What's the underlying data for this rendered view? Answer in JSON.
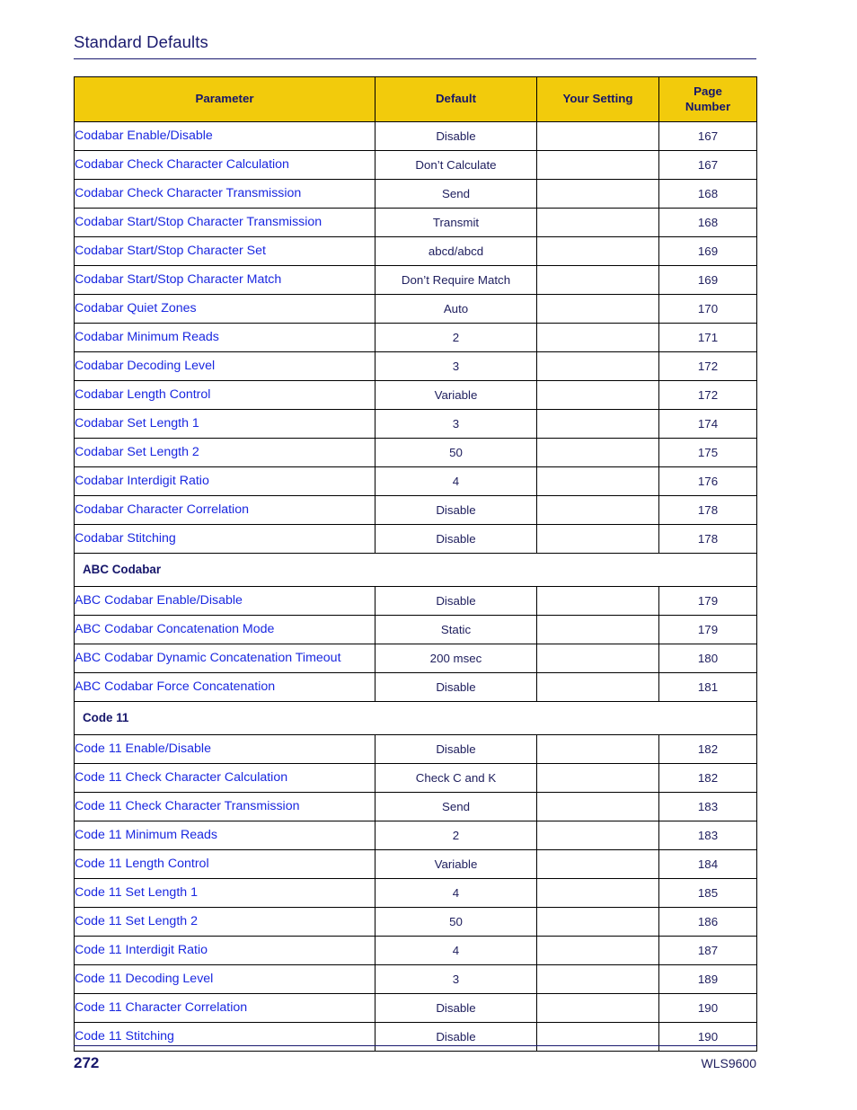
{
  "document": {
    "section_title": "Standard Defaults",
    "footer_page_number": "272",
    "footer_document_name": "WLS9600"
  },
  "colors": {
    "header_background": "#F2CB0C",
    "header_text": "#16166B",
    "link_text": "#1A28E0",
    "body_text": "#20205F",
    "rule": "#1A1A6E"
  },
  "table": {
    "columns": [
      {
        "key": "parameter",
        "label": "Parameter"
      },
      {
        "key": "default",
        "label": "Default"
      },
      {
        "key": "your_setting",
        "label": "Your Setting"
      },
      {
        "key": "page_number",
        "label": "Page\nNumber"
      }
    ],
    "column_labels": {
      "parameter": "Parameter",
      "default": "Default",
      "your_setting": "Your Setting",
      "page_number_line1": "Page",
      "page_number_line2": "Number"
    },
    "rows": [
      {
        "type": "data",
        "parameter": "Codabar Enable/Disable",
        "default": "Disable",
        "your_setting": "",
        "page": "167"
      },
      {
        "type": "data",
        "parameter": "Codabar Check Character Calculation",
        "default": "Don’t Calculate",
        "your_setting": "",
        "page": "167"
      },
      {
        "type": "data",
        "parameter": "Codabar Check Character Transmission",
        "default": "Send",
        "your_setting": "",
        "page": "168"
      },
      {
        "type": "data",
        "parameter": "Codabar Start/Stop Character Transmission",
        "default": "Transmit",
        "your_setting": "",
        "page": "168"
      },
      {
        "type": "data",
        "parameter": "Codabar Start/Stop Character Set",
        "default": "abcd/abcd",
        "your_setting": "",
        "page": "169"
      },
      {
        "type": "data",
        "parameter": "Codabar Start/Stop Character Match",
        "default": "Don’t Require Match",
        "your_setting": "",
        "page": "169"
      },
      {
        "type": "data",
        "parameter": "Codabar Quiet Zones",
        "default": "Auto",
        "your_setting": "",
        "page": "170"
      },
      {
        "type": "data",
        "parameter": "Codabar Minimum Reads",
        "default": "2",
        "your_setting": "",
        "page": "171"
      },
      {
        "type": "data",
        "parameter": "Codabar Decoding Level",
        "default": "3",
        "your_setting": "",
        "page": "172"
      },
      {
        "type": "data",
        "parameter": "Codabar Length Control",
        "default": "Variable",
        "your_setting": "",
        "page": "172"
      },
      {
        "type": "data",
        "parameter": "Codabar Set Length 1",
        "default": "3",
        "your_setting": "",
        "page": "174"
      },
      {
        "type": "data",
        "parameter": "Codabar Set Length 2",
        "default": "50",
        "your_setting": "",
        "page": "175"
      },
      {
        "type": "data",
        "parameter": "Codabar Interdigit Ratio",
        "default": "4",
        "your_setting": "",
        "page": "176"
      },
      {
        "type": "data",
        "parameter": "Codabar Character Correlation",
        "default": "Disable",
        "your_setting": "",
        "page": "178"
      },
      {
        "type": "data",
        "parameter": "Codabar Stitching",
        "default": "Disable",
        "your_setting": "",
        "page": "178"
      },
      {
        "type": "section",
        "parameter": "ABC Codabar"
      },
      {
        "type": "data",
        "parameter": "ABC Codabar Enable/Disable",
        "default": "Disable",
        "your_setting": "",
        "page": "179"
      },
      {
        "type": "data",
        "parameter": "ABC Codabar Concatenation Mode",
        "default": "Static",
        "your_setting": "",
        "page": "179"
      },
      {
        "type": "data",
        "parameter": "ABC Codabar Dynamic Concatenation Timeout",
        "default": "200 msec",
        "your_setting": "",
        "page": "180"
      },
      {
        "type": "data",
        "parameter": "ABC Codabar Force Concatenation",
        "default": "Disable",
        "your_setting": "",
        "page": "181"
      },
      {
        "type": "section",
        "parameter": "Code 11"
      },
      {
        "type": "data",
        "parameter": "Code 11 Enable/Disable",
        "default": "Disable",
        "your_setting": "",
        "page": "182"
      },
      {
        "type": "data",
        "parameter": "Code 11 Check Character Calculation",
        "default": "Check C and K",
        "your_setting": "",
        "page": "182"
      },
      {
        "type": "data",
        "parameter": "Code 11 Check Character Transmission",
        "default": "Send",
        "your_setting": "",
        "page": "183"
      },
      {
        "type": "data",
        "parameter": "Code 11 Minimum Reads",
        "default": "2",
        "your_setting": "",
        "page": "183"
      },
      {
        "type": "data",
        "parameter": "Code 11 Length Control",
        "default": "Variable",
        "your_setting": "",
        "page": "184"
      },
      {
        "type": "data",
        "parameter": "Code 11 Set Length 1",
        "default": "4",
        "your_setting": "",
        "page": "185"
      },
      {
        "type": "data",
        "parameter": "Code 11 Set Length 2",
        "default": "50",
        "your_setting": "",
        "page": "186"
      },
      {
        "type": "data",
        "parameter": "Code 11 Interdigit Ratio",
        "default": "4",
        "your_setting": "",
        "page": "187"
      },
      {
        "type": "data",
        "parameter": "Code 11 Decoding Level",
        "default": "3",
        "your_setting": "",
        "page": "189"
      },
      {
        "type": "data",
        "parameter": "Code 11 Character Correlation",
        "default": "Disable",
        "your_setting": "",
        "page": "190"
      },
      {
        "type": "data",
        "parameter": "Code 11 Stitching",
        "default": "Disable",
        "your_setting": "",
        "page": "190"
      }
    ]
  }
}
